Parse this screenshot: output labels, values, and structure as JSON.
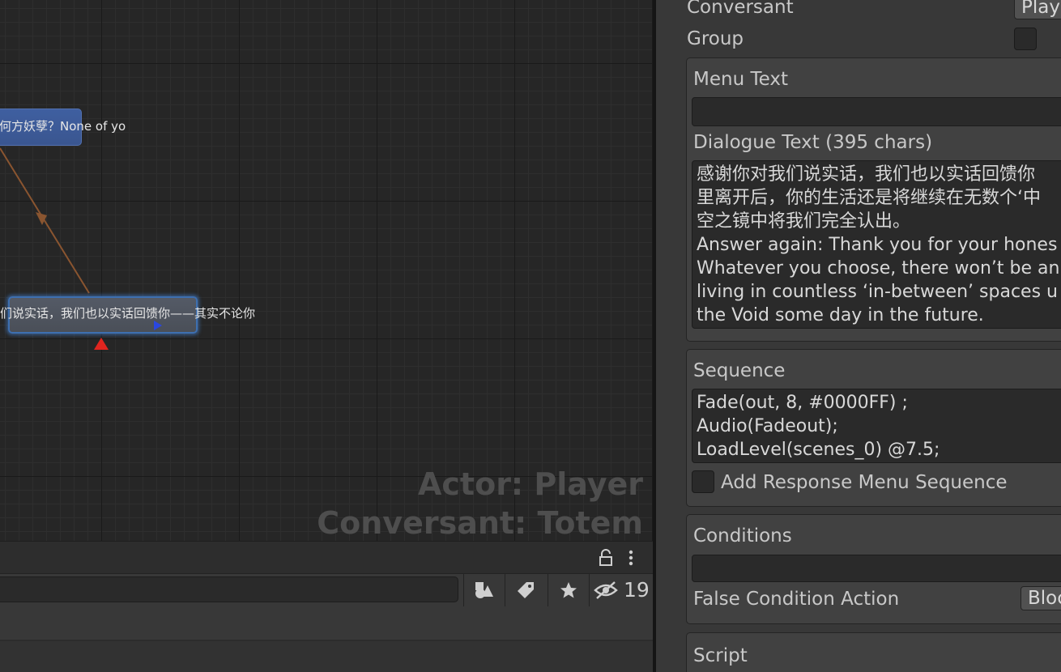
{
  "graph": {
    "nodes": [
      {
        "id": "node-a",
        "text": "何方妖孽？None of yo"
      },
      {
        "id": "node-b",
        "text": "们说实话，我们也以实话回馈你——其实不论你"
      }
    ],
    "overlay": {
      "actor": "Actor: Player",
      "conversant": "Conversant: Totem"
    }
  },
  "toolbar": {
    "search_value": "",
    "hidden_count": "19",
    "icons": [
      "lock-icon",
      "more-vertical-icon",
      "shapes-filter-icon",
      "tag-icon",
      "star-icon",
      "eye-hidden-icon"
    ]
  },
  "inspector": {
    "conversant_label": "Conversant",
    "conversant_value": "Play",
    "group_label": "Group",
    "menu_text_label": "Menu Text",
    "menu_text_value": "",
    "dialogue_text_label": "Dialogue Text (395 chars)",
    "dialogue_lines": [
      "感谢你对我们说实话，我们也以实话回馈你",
      "里离开后，你的生活还是将继续在无数个‘中",
      "空之镜中将我们完全认出。",
      "Answer again: Thank you for your hones",
      "Whatever you choose, there won’t be an",
      "living in countless ‘in-between’ spaces u",
      "the Void some day in the future."
    ],
    "sequence_label": "Sequence",
    "sequence_lines": [
      "Fade(out, 8, #0000FF) ;",
      "Audio(Fadeout);",
      "LoadLevel(scenes_0) @7.5;"
    ],
    "add_response_label": "Add Response Menu Sequence",
    "conditions_label": "Conditions",
    "conditions_value": "",
    "false_condition_label": "False Condition Action",
    "false_condition_value": "Bloc",
    "script_label": "Script"
  }
}
